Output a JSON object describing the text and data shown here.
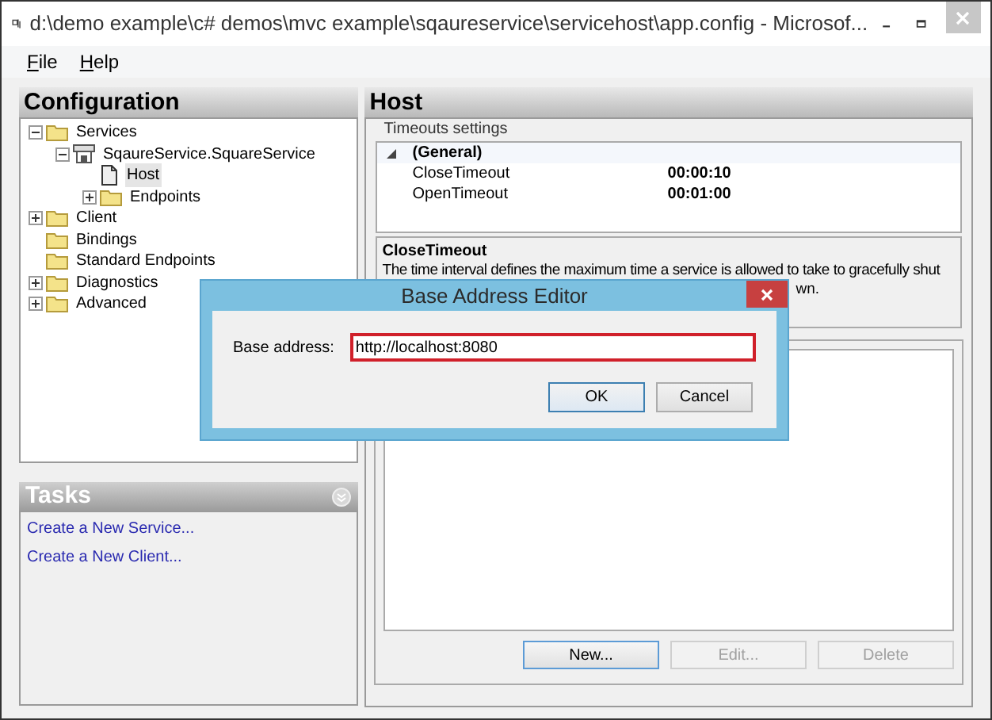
{
  "window": {
    "title": "d:\\demo example\\c# demos\\mvc example\\sqaureservice\\servicehost\\app.config - Microsof..."
  },
  "menu": [
    "File",
    "Help"
  ],
  "configuration": {
    "title": "Configuration",
    "tree": [
      {
        "label": "Services",
        "kind": "folder",
        "expanded": true,
        "selected": false,
        "children": [
          {
            "label": "SqaureService.SquareService",
            "kind": "service",
            "expanded": true,
            "selected": false,
            "children": [
              {
                "label": "Host",
                "kind": "document",
                "selected": true
              },
              {
                "label": "Endpoints",
                "kind": "folder",
                "expanded": false,
                "selected": false
              }
            ]
          }
        ]
      },
      {
        "label": "Client",
        "kind": "folder",
        "expanded": false,
        "selected": false
      },
      {
        "label": "Bindings",
        "kind": "folder",
        "selected": false
      },
      {
        "label": "Standard Endpoints",
        "kind": "folder",
        "selected": false
      },
      {
        "label": "Diagnostics",
        "kind": "folder",
        "expanded": false,
        "selected": false
      },
      {
        "label": "Advanced",
        "kind": "folder",
        "expanded": false,
        "selected": false
      }
    ]
  },
  "tasks": {
    "title": "Tasks",
    "links": [
      "Create a New Service...",
      "Create a New Client..."
    ]
  },
  "host": {
    "title": "Host",
    "group_title": "Timeouts settings",
    "property_grid": {
      "category": "(General)",
      "rows": [
        {
          "name": "CloseTimeout",
          "value": "00:00:10"
        },
        {
          "name": "OpenTimeout",
          "value": "00:01:00"
        }
      ]
    },
    "description": {
      "title": "CloseTimeout",
      "lines": [
        "The time interval defines the maximum time a service is allowed to take to gracefully shut",
        "wn."
      ]
    },
    "buttons": [
      {
        "label": "New...",
        "disabled": false
      },
      {
        "label": "Edit...",
        "disabled": true
      },
      {
        "label": "Delete",
        "disabled": true
      }
    ]
  },
  "dialog": {
    "title": "Base Address Editor",
    "field_label": "Base address:",
    "value": "http://localhost:8080",
    "buttons": [
      "OK",
      "Cancel"
    ]
  }
}
